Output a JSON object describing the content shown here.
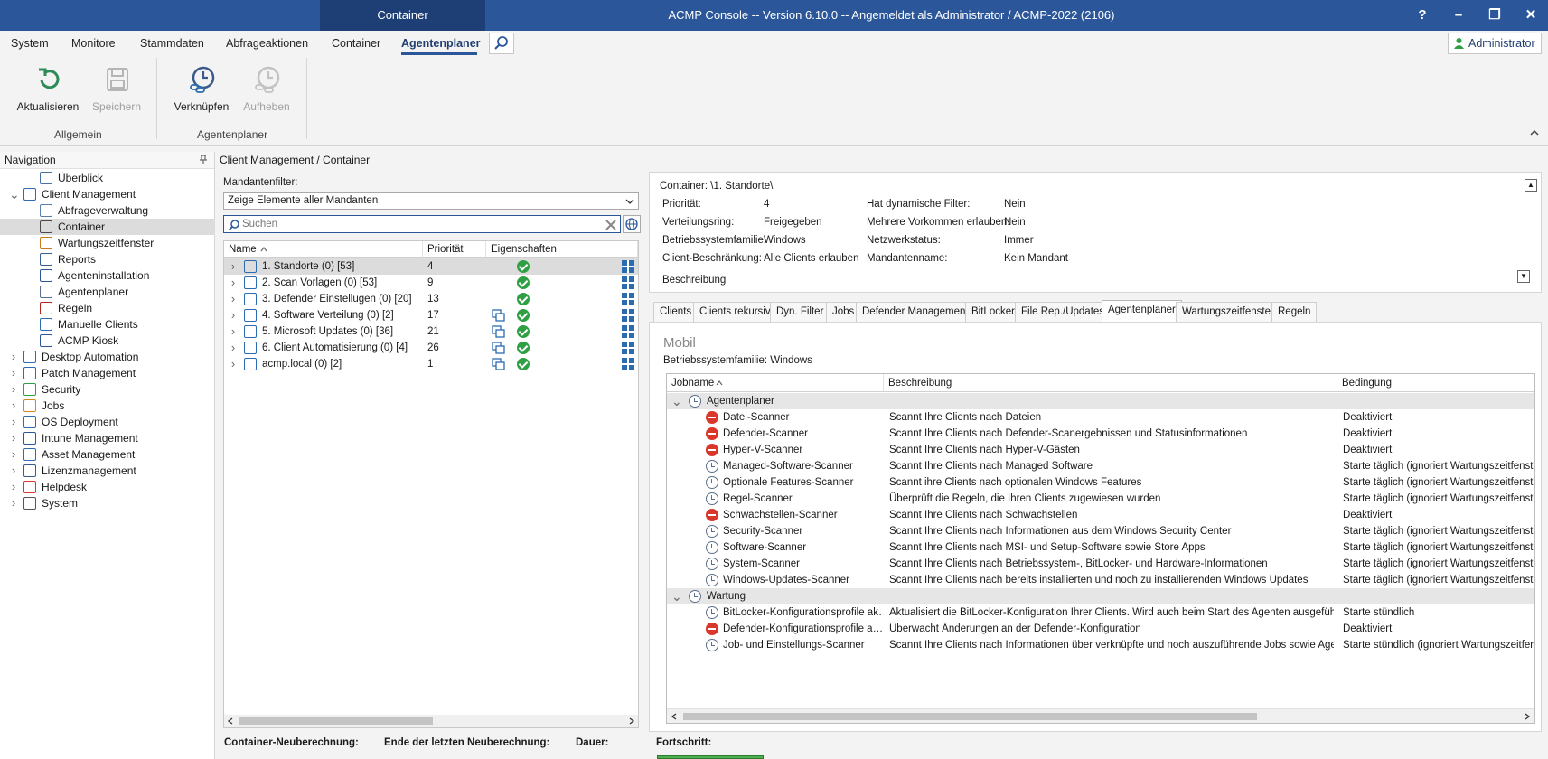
{
  "titlebar": {
    "context_tab": "Container",
    "title": "ACMP Console -- Version 6.10.0 -- Angemeldet als Administrator / ACMP-2022 (2106)",
    "help": "?",
    "minimize": "–",
    "restore": "❐",
    "close": "✕"
  },
  "menu": {
    "items": [
      "System",
      "Monitore",
      "Stammdaten",
      "Abfrageaktionen",
      "Container",
      "Agentenplaner"
    ],
    "active": "Agentenplaner",
    "user": "Administrator"
  },
  "ribbon": {
    "buttons": {
      "refresh": "Aktualisieren",
      "save": "Speichern",
      "link": "Verknüpfen",
      "unlink": "Aufheben"
    },
    "groups": [
      "Allgemein",
      "Agentenplaner"
    ]
  },
  "navigation": {
    "title": "Navigation",
    "items": [
      {
        "label": "Überblick",
        "level": 1
      },
      {
        "label": "Client Management",
        "level": 0,
        "expanded": true
      },
      {
        "label": "Abfrageverwaltung",
        "level": 1
      },
      {
        "label": "Container",
        "level": 1,
        "selected": true
      },
      {
        "label": "Wartungszeitfenster",
        "level": 1
      },
      {
        "label": "Reports",
        "level": 1
      },
      {
        "label": "Agenteninstallation",
        "level": 1
      },
      {
        "label": "Agentenplaner",
        "level": 1
      },
      {
        "label": "Regeln",
        "level": 1
      },
      {
        "label": "Manuelle Clients",
        "level": 1
      },
      {
        "label": "ACMP Kiosk",
        "level": 1
      },
      {
        "label": "Desktop Automation",
        "level": 0
      },
      {
        "label": "Patch Management",
        "level": 0
      },
      {
        "label": "Security",
        "level": 0
      },
      {
        "label": "Jobs",
        "level": 0
      },
      {
        "label": "OS Deployment",
        "level": 0
      },
      {
        "label": "Intune Management",
        "level": 0
      },
      {
        "label": "Asset Management",
        "level": 0
      },
      {
        "label": "Lizenzmanagement",
        "level": 0
      },
      {
        "label": "Helpdesk",
        "level": 0
      },
      {
        "label": "System",
        "level": 0
      }
    ]
  },
  "breadcrumb": "Client Management / Container",
  "containers": {
    "filter_label": "Mandantenfilter:",
    "filter_value": "Zeige Elemente aller Mandanten",
    "search_placeholder": "Suchen",
    "columns": [
      "Name",
      "Priorität",
      "Eigenschaften"
    ],
    "rows": [
      {
        "name": "1. Standorte (0) [53]",
        "prio": "4",
        "link": false
      },
      {
        "name": "2. Scan Vorlagen (0) [53]",
        "prio": "9",
        "link": false
      },
      {
        "name": "3. Defender Einstellugen (0) [20]",
        "prio": "13",
        "link": false
      },
      {
        "name": "4. Software Verteilung (0) [2]",
        "prio": "17",
        "link": true
      },
      {
        "name": "5. Microsoft Updates (0) [36]",
        "prio": "21",
        "link": true
      },
      {
        "name": "6. Client Automatisierung (0) [4]",
        "prio": "26",
        "link": true
      },
      {
        "name": "acmp.local (0) [2]",
        "prio": "1",
        "link": true
      }
    ]
  },
  "status": {
    "recalc_label": "Container-Neuberechnung:",
    "last_label": "Ende der letzten Neuberechnung:",
    "duration_label": "Dauer:",
    "progress_label": "Fortschritt:",
    "progress": 1.0
  },
  "container_info": {
    "title": "Container: \\1. Standorte\\",
    "left": [
      {
        "k": "Priorität:",
        "v": "4"
      },
      {
        "k": "Verteilungsring:",
        "v": "Freigegeben"
      },
      {
        "k": "Betriebssystemfamilie:",
        "v": "Windows"
      },
      {
        "k": "Client-Beschränkung:",
        "v": "Alle Clients erlauben"
      }
    ],
    "right": [
      {
        "k": "Hat dynamische Filter:",
        "v": "Nein"
      },
      {
        "k": "Mehrere Vorkommen erlauben:",
        "v": "Nein"
      },
      {
        "k": "Netzwerkstatus:",
        "v": "Immer"
      },
      {
        "k": "Mandantenname:",
        "v": "Kein Mandant"
      }
    ],
    "description_label": "Beschreibung"
  },
  "tabs": [
    "Clients",
    "Clients rekursiv",
    "Dyn. Filter",
    "Jobs",
    "Defender Management",
    "BitLocker",
    "File Rep./Updates",
    "Agentenplaner",
    "Wartungszeitfenster",
    "Regeln"
  ],
  "active_tab": "Agentenplaner",
  "agentenplaner": {
    "section": "Mobil",
    "os_label": "Betriebssystemfamilie:",
    "os_value": "Windows",
    "columns": [
      "Jobname",
      "Beschreibung",
      "Bedingung"
    ],
    "groups": [
      {
        "name": "Agentenplaner",
        "jobs": [
          {
            "name": "Datei-Scanner",
            "desc": "Scannt Ihre Clients nach Dateien",
            "cond": "Deaktiviert",
            "disabled": true
          },
          {
            "name": "Defender-Scanner",
            "desc": "Scannt Ihre Clients nach Defender-Scanergebnissen und Statusinformationen",
            "cond": "Deaktiviert",
            "disabled": true
          },
          {
            "name": "Hyper-V-Scanner",
            "desc": "Scannt Ihre Clients nach Hyper-V-Gästen",
            "cond": "Deaktiviert",
            "disabled": true
          },
          {
            "name": "Managed-Software-Scanner",
            "desc": "Scannt Ihre Clients nach Managed Software",
            "cond": "Starte täglich (ignoriert Wartungszeitfenst",
            "disabled": false
          },
          {
            "name": "Optionale Features-Scanner",
            "desc": "Scannt ihre Clients nach optionalen Windows Features",
            "cond": "Starte täglich (ignoriert Wartungszeitfenst",
            "disabled": false
          },
          {
            "name": "Regel-Scanner",
            "desc": "Überprüft die Regeln, die Ihren Clients zugewiesen wurden",
            "cond": "Starte täglich (ignoriert Wartungszeitfenst",
            "disabled": false
          },
          {
            "name": "Schwachstellen-Scanner",
            "desc": "Scannt Ihre Clients nach Schwachstellen",
            "cond": "Deaktiviert",
            "disabled": true
          },
          {
            "name": "Security-Scanner",
            "desc": "Scannt Ihre Clients nach Informationen aus dem Windows Security Center",
            "cond": "Starte täglich (ignoriert Wartungszeitfenst",
            "disabled": false
          },
          {
            "name": "Software-Scanner",
            "desc": "Scannt Ihre Clients nach MSI- und Setup-Software sowie Store Apps",
            "cond": "Starte täglich (ignoriert Wartungszeitfenst",
            "disabled": false
          },
          {
            "name": "System-Scanner",
            "desc": "Scannt Ihre Clients nach Betriebssystem-, BitLocker- und Hardware-Informationen",
            "cond": "Starte täglich (ignoriert Wartungszeitfenst",
            "disabled": false
          },
          {
            "name": "Windows-Updates-Scanner",
            "desc": "Scannt Ihre Clients nach bereits installierten und noch zu installierenden Windows Updates",
            "cond": "Starte täglich (ignoriert Wartungszeitfenst",
            "disabled": false
          }
        ]
      },
      {
        "name": "Wartung",
        "jobs": [
          {
            "name": "BitLocker-Konfigurationsprofile ak…",
            "desc": "Aktualisiert die BitLocker-Konfiguration Ihrer Clients. Wird auch beim Start  des Agenten ausgeführt.",
            "cond": "Starte stündlich",
            "disabled": false
          },
          {
            "name": "Defender-Konfigurationsprofile a…",
            "desc": "Überwacht Änderungen an der Defender-Konfiguration",
            "cond": "Deaktiviert",
            "disabled": true
          },
          {
            "name": "Job- und Einstellungs-Scanner",
            "desc": "Scannt Ihre Clients nach Informationen über verknüpfte und noch auszuführende Jobs sowie Agent…",
            "cond": "Starte stündlich (ignoriert Wartungszeitfer",
            "disabled": false
          }
        ]
      }
    ]
  }
}
